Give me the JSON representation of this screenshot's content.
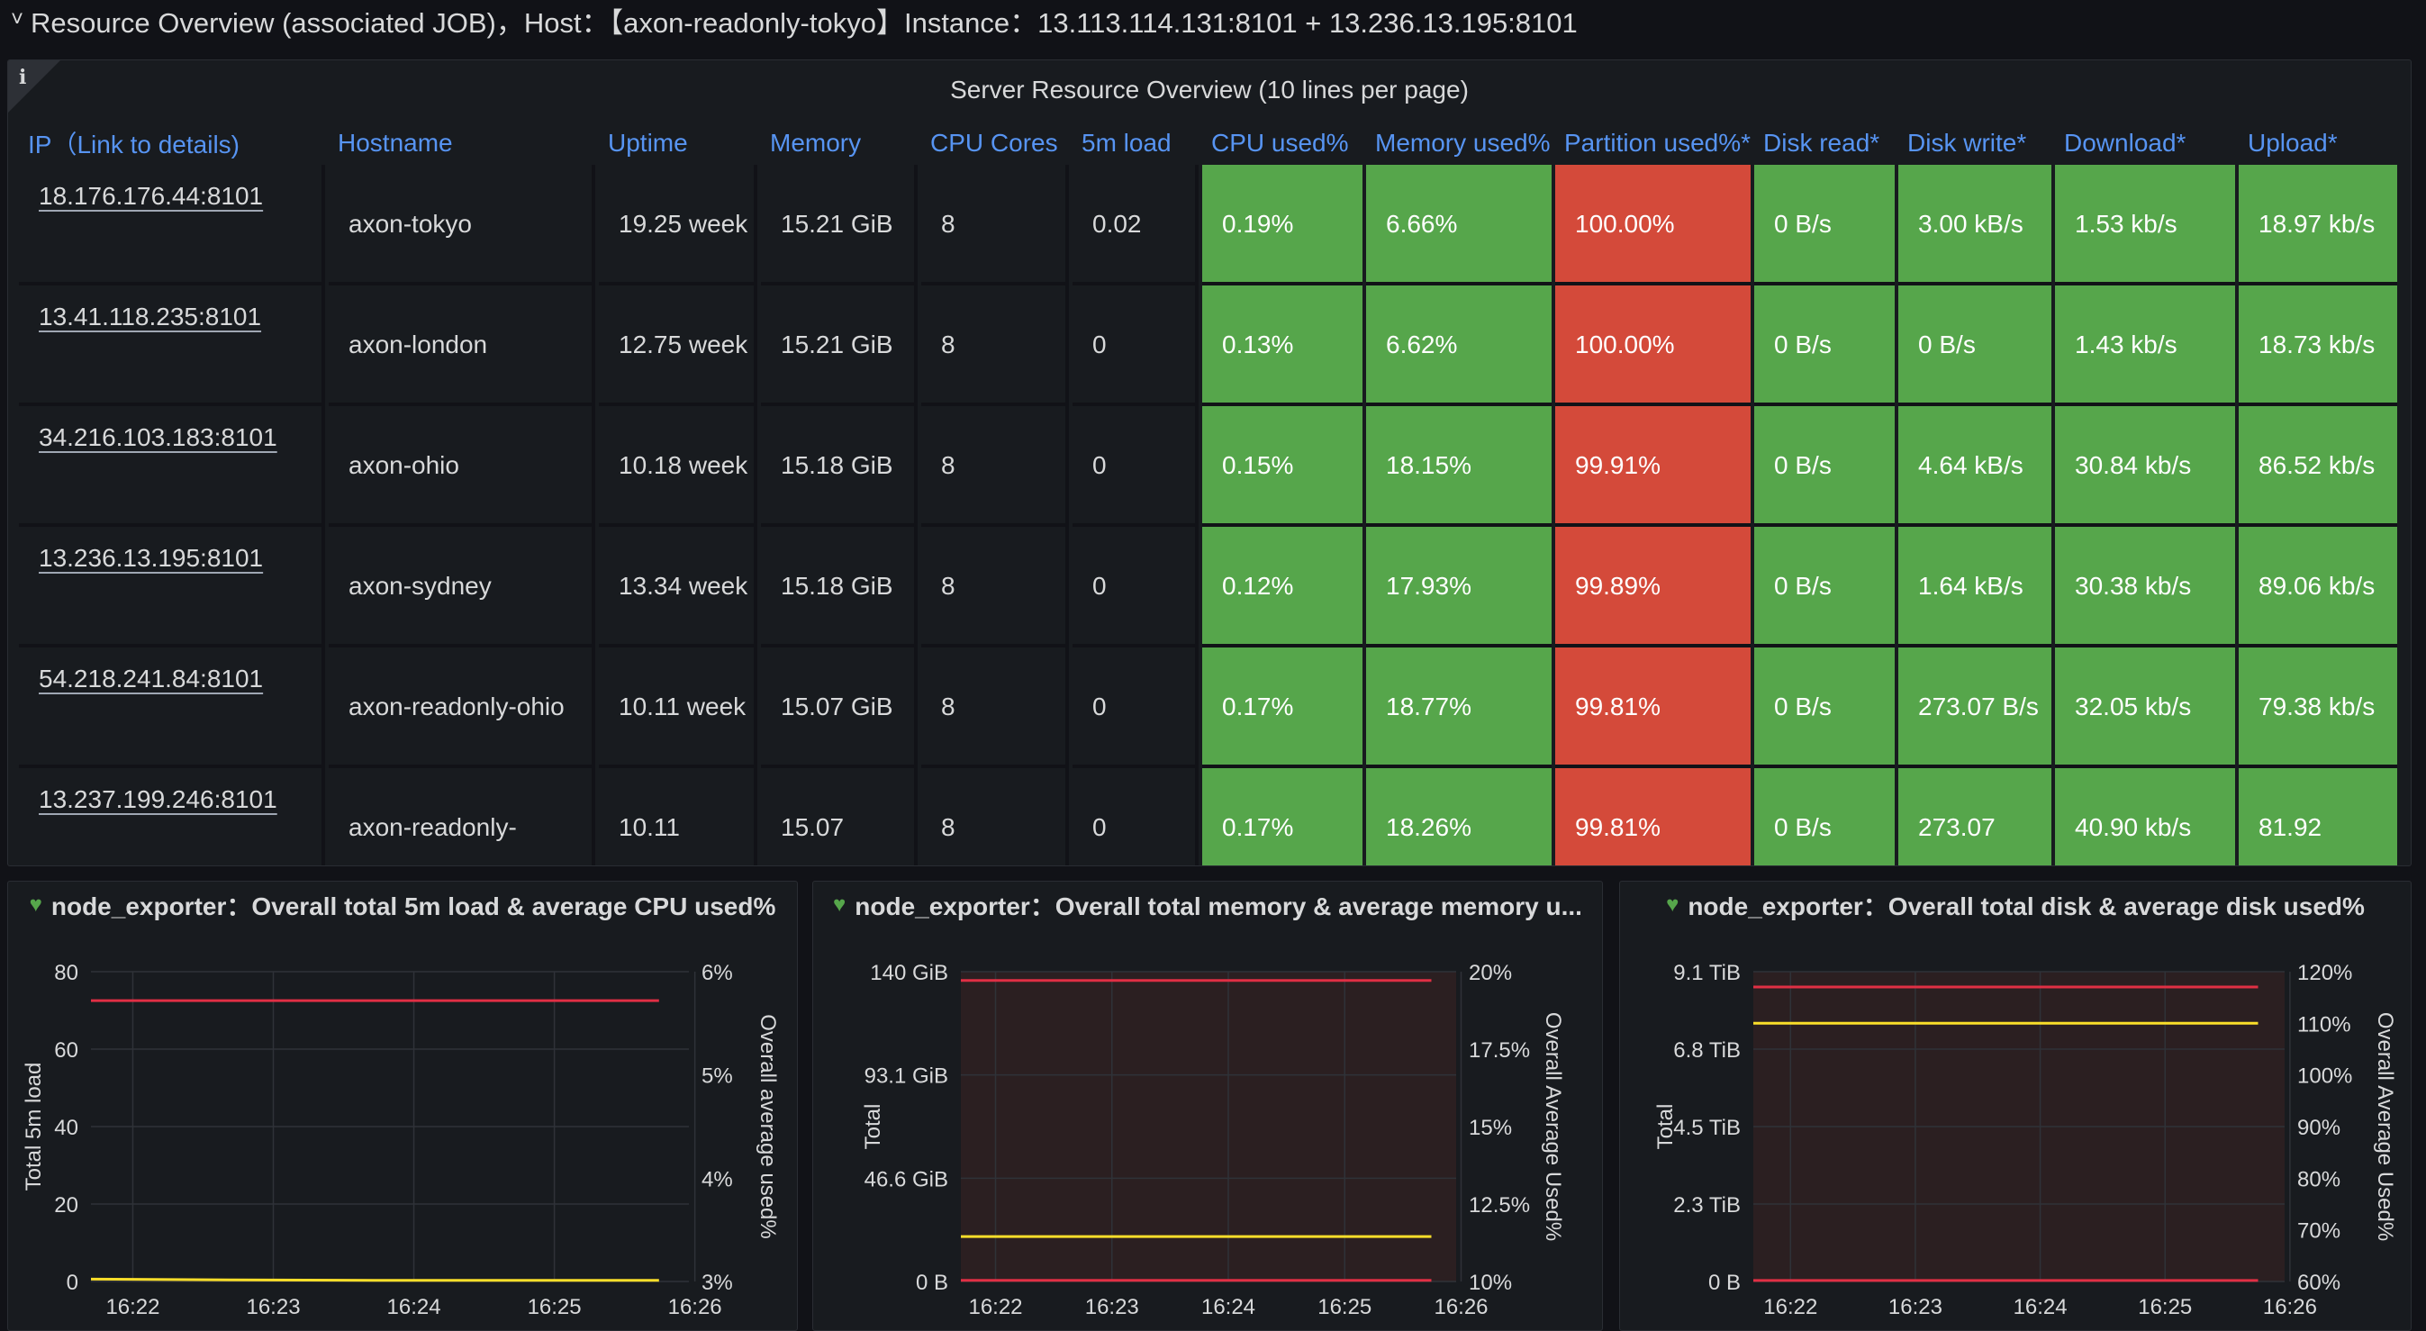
{
  "row_header": {
    "chevron": "chevron-down-icon",
    "title": "Resource Overview (associated JOB)，Host：【axon-readonly-tokyo】Instance：13.113.114.131:8101 + 13.236.13.195:8101"
  },
  "table": {
    "info_icon": "i",
    "title": "Server Resource Overview (10 lines per page)",
    "columns": [
      "IP（Link to details)",
      "Hostname",
      "Uptime",
      "Memory",
      "CPU Cores",
      "5m load",
      "CPU used%",
      "Memory used%",
      "Partition used%*",
      "Disk read*",
      "Disk write*",
      "Download*",
      "Upload*"
    ],
    "rows": [
      {
        "ip": "18.176.176.44:8101",
        "hostname": "axon-tokyo",
        "uptime": "19.25 week",
        "memory": "15.21 GiB",
        "cores": "8",
        "load": "0.02",
        "cpu": "0.19%",
        "mem_used": "6.66%",
        "partition": "100.00%",
        "disk_read": "0 B/s",
        "disk_write": "3.00 kB/s",
        "download": "1.53 kb/s",
        "upload": "18.97 kb/s"
      },
      {
        "ip": "13.41.118.235:8101",
        "hostname": "axon-london",
        "uptime": "12.75 week",
        "memory": "15.21 GiB",
        "cores": "8",
        "load": "0",
        "cpu": "0.13%",
        "mem_used": "6.62%",
        "partition": "100.00%",
        "disk_read": "0 B/s",
        "disk_write": "0 B/s",
        "download": "1.43 kb/s",
        "upload": "18.73 kb/s"
      },
      {
        "ip": "34.216.103.183:8101",
        "hostname": "axon-ohio",
        "uptime": "10.18 week",
        "memory": "15.18 GiB",
        "cores": "8",
        "load": "0",
        "cpu": "0.15%",
        "mem_used": "18.15%",
        "partition": "99.91%",
        "disk_read": "0 B/s",
        "disk_write": "4.64 kB/s",
        "download": "30.84 kb/s",
        "upload": "86.52 kb/s"
      },
      {
        "ip": "13.236.13.195:8101",
        "hostname": "axon-sydney",
        "uptime": "13.34 week",
        "memory": "15.18 GiB",
        "cores": "8",
        "load": "0",
        "cpu": "0.12%",
        "mem_used": "17.93%",
        "partition": "99.89%",
        "disk_read": "0 B/s",
        "disk_write": "1.64 kB/s",
        "download": "30.38 kb/s",
        "upload": "89.06 kb/s"
      },
      {
        "ip": "54.218.241.84:8101",
        "hostname": "axon-readonly-ohio",
        "uptime": "10.11 week",
        "memory": "15.07 GiB",
        "cores": "8",
        "load": "0",
        "cpu": "0.17%",
        "mem_used": "18.77%",
        "partition": "99.81%",
        "disk_read": "0 B/s",
        "disk_write": "273.07 B/s",
        "download": "32.05 kb/s",
        "upload": "79.38 kb/s"
      },
      {
        "ip": "13.237.199.246:8101",
        "hostname": "axon-readonly-",
        "uptime": "10.11",
        "memory": "15.07",
        "cores": "8",
        "load": "0",
        "cpu": "0.17%",
        "mem_used": "18.26%",
        "partition": "99.81%",
        "disk_read": "0 B/s",
        "disk_write": "273.07",
        "download": "40.90 kb/s",
        "upload": "81.92"
      }
    ],
    "colors": {
      "ok": "#56a64b",
      "bad": "#d44a3a",
      "header": "#5794f2"
    }
  },
  "chart_data": [
    {
      "type": "line",
      "title": "node_exporter：Overall total 5m load & average CPU used%",
      "status_icon": "heart-icon",
      "x": [
        "16:22",
        "16:23",
        "16:24",
        "16:25",
        "16:26"
      ],
      "ylabel": "Total 5m load",
      "y2label": "Overall average used%",
      "yticks": [
        "80",
        "60",
        "40",
        "20",
        "0"
      ],
      "y2ticks": [
        "6%",
        "5%",
        "4%",
        "3%"
      ],
      "ylim": [
        0,
        80
      ],
      "y2lim": [
        3,
        6
      ],
      "shaded": false,
      "series": [
        {
          "axis": "left",
          "color": "#fade2a",
          "values": [
            0.6,
            0.4,
            0.3,
            0.3,
            0.3
          ]
        },
        {
          "axis": "right",
          "color": "#e02f44",
          "values": [
            5.72,
            5.72,
            5.72,
            5.72,
            5.72
          ]
        }
      ]
    },
    {
      "type": "line",
      "title": "node_exporter：Overall total memory & average memory u...",
      "status_icon": "heart-icon",
      "x": [
        "16:22",
        "16:23",
        "16:24",
        "16:25",
        "16:26"
      ],
      "ylabel": "Total",
      "y2label": "Overall Average Used%",
      "yticks": [
        "140 GiB",
        "93.1 GiB",
        "46.6 GiB",
        "0 B"
      ],
      "y2ticks": [
        "20%",
        "17.5%",
        "15%",
        "12.5%",
        "10%"
      ],
      "ylim": [
        0,
        140
      ],
      "y2lim": [
        10,
        20
      ],
      "shaded": true,
      "series": [
        {
          "axis": "left",
          "color": "#e02f44",
          "values": [
            0.5,
            0.5,
            0.5,
            0.5,
            0.5
          ]
        },
        {
          "axis": "left",
          "color": "#e02f44",
          "values": [
            136,
            136,
            136,
            136,
            136
          ]
        },
        {
          "axis": "right",
          "color": "#fade2a",
          "values": [
            11.45,
            11.45,
            11.45,
            11.45,
            11.45
          ]
        }
      ]
    },
    {
      "type": "line",
      "title": "node_exporter：Overall total disk & average disk used%",
      "status_icon": "heart-icon",
      "x": [
        "16:22",
        "16:23",
        "16:24",
        "16:25",
        "16:26"
      ],
      "ylabel": "Total",
      "y2label": "Overall Average Used%",
      "yticks": [
        "9.1 TiB",
        "6.8 TiB",
        "4.5 TiB",
        "2.3 TiB",
        "0 B"
      ],
      "y2ticks": [
        "120%",
        "110%",
        "100%",
        "90%",
        "80%",
        "70%",
        "60%"
      ],
      "ylim": [
        0,
        9.1
      ],
      "y2lim": [
        60,
        120
      ],
      "shaded": true,
      "series": [
        {
          "axis": "left",
          "color": "#e02f44",
          "values": [
            0.03,
            0.03,
            0.03,
            0.03,
            0.03
          ]
        },
        {
          "axis": "left",
          "color": "#e02f44",
          "values": [
            8.65,
            8.65,
            8.65,
            8.65,
            8.65
          ]
        },
        {
          "axis": "right",
          "color": "#fade2a",
          "values": [
            110,
            110,
            110,
            110,
            110
          ]
        }
      ]
    }
  ]
}
